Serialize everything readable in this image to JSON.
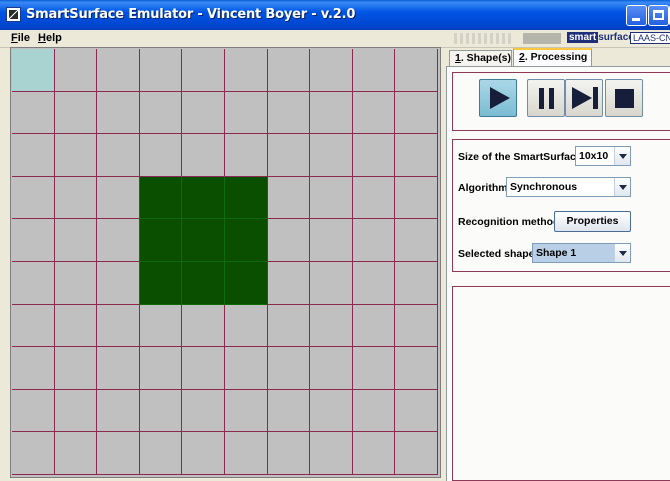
{
  "window": {
    "title": "SmartSurface Emulator - Vincent Boyer - v.2.0"
  },
  "menu": {
    "file": "File",
    "help": "Help"
  },
  "logos": {
    "smart": "smart",
    "surface": "surface",
    "laas": "LAAS-CNRS"
  },
  "grid": {
    "rows": 10,
    "cols": 10,
    "selected_cell": [
      0,
      0
    ],
    "active_cells": [
      [
        3,
        3
      ],
      [
        3,
        4
      ],
      [
        3,
        5
      ],
      [
        4,
        3
      ],
      [
        4,
        4
      ],
      [
        4,
        5
      ],
      [
        5,
        3
      ],
      [
        5,
        4
      ],
      [
        5,
        5
      ]
    ],
    "colors": {
      "empty": "#c0c0c0",
      "active": "#0a4f00",
      "selected": "#a8d3d1",
      "border": "#8b2a4e"
    }
  },
  "tabs": [
    {
      "mnemonic": "1",
      "rest": ". Shape(s)"
    },
    {
      "mnemonic": "2",
      "rest": ". Processing"
    }
  ],
  "controls": {
    "play": "play-icon",
    "pause": "pause-icon",
    "step": "step-forward-icon",
    "stop": "stop-icon"
  },
  "settings": {
    "size_label": "Size of the SmartSurface:",
    "size_value": "10x10",
    "algorithm_label": "Algorithm:",
    "algorithm_value": "Synchronous",
    "recognition_label": "Recognition method:",
    "recognition_button": "Properties",
    "shape_label": "Selected shape:",
    "shape_value": "Shape 1"
  }
}
